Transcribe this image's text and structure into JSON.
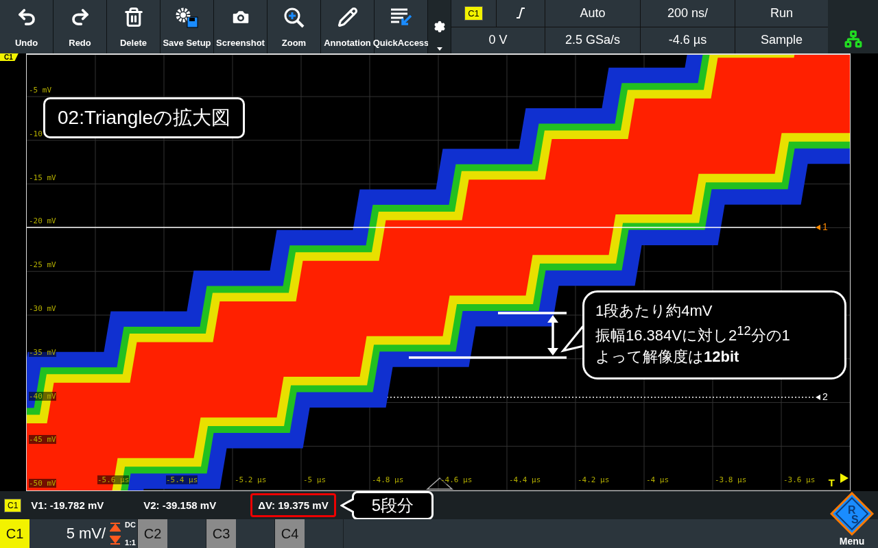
{
  "toolbar": {
    "buttons": [
      {
        "label": "Undo",
        "kind": "undo"
      },
      {
        "label": "Redo",
        "kind": "redo"
      },
      {
        "label": "Delete",
        "kind": "delete"
      },
      {
        "label": "Save Setup",
        "kind": "save"
      },
      {
        "label": "Screenshot",
        "kind": "camera"
      },
      {
        "label": "Zoom",
        "kind": "zoom"
      },
      {
        "label": "Annotation",
        "kind": "pencil"
      },
      {
        "label": "QuickAccess",
        "kind": "quick"
      }
    ]
  },
  "trigger": {
    "source": "C1",
    "trigger_level": "0 V",
    "mode": "Auto",
    "sample_rate": "2.5 GSa/s",
    "timebase": "200 ns/",
    "position": "-4.6 µs",
    "run_state": "Run",
    "acquisition": "Sample"
  },
  "plot": {
    "channel_tag": "C1",
    "trigger_tag": "T",
    "y_labels": [
      "-5 mV",
      "-10",
      "-15 mV",
      "-20 mV",
      "-25 mV",
      "-30 mV",
      "-35 mV",
      "-40 mV",
      "-45 mV",
      "-50 mV"
    ],
    "x_labels": [
      "-5.6 µs",
      "-5.4 µs",
      "-5.2 µs",
      "-5 µs",
      "-4.8 µs",
      "-4.6 µs",
      "-4.4 µs",
      "-4.2 µs",
      "-4 µs",
      "-3.8 µs",
      "-3.6 µs"
    ],
    "cursors": [
      {
        "label": "1",
        "kind": "solid"
      },
      {
        "label": "2",
        "kind": "dotted"
      }
    ],
    "title_callout": "02:Triangleの拡大図",
    "note_lines": [
      "1段あたり約4mV",
      "振幅16.384Vに対し2$^{12}$分の1",
      "よって解像度は**12bit**"
    ]
  },
  "measurements": {
    "channel": "C1",
    "items": [
      {
        "text": "V1: -19.782 mV",
        "highlighted": false
      },
      {
        "text": "V2: -39.158 mV",
        "highlighted": false
      },
      {
        "text": "ΔV: 19.375 mV",
        "highlighted": true
      }
    ],
    "callout": "5段分"
  },
  "channels": [
    {
      "name": "C1",
      "active": true,
      "scale": "5 mV/",
      "coupling": "DC",
      "probe": "1:1"
    },
    {
      "name": "C2",
      "active": false
    },
    {
      "name": "C3",
      "active": false
    },
    {
      "name": "C4",
      "active": false
    }
  ],
  "menu": {
    "label": "Menu",
    "logo_letters": [
      "R",
      "S"
    ]
  }
}
